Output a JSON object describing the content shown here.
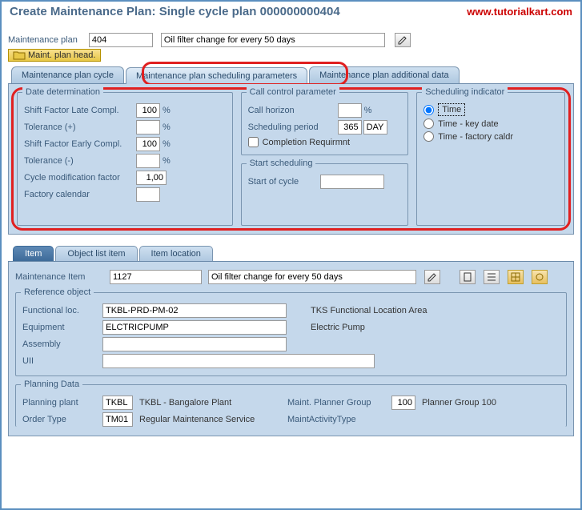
{
  "title": "Create Maintenance Plan: Single cycle plan 000000000404",
  "watermark": "www.tutorialkart.com",
  "header": {
    "plan_label": "Maintenance plan",
    "plan_value": "404",
    "plan_desc": "Oil filter change for every 50 days",
    "head_button": "Maint. plan head."
  },
  "tabs": {
    "t1": "Maintenance plan cycle",
    "t2": "Maintenance plan scheduling parameters",
    "t3": "Maintenance plan additional data"
  },
  "date_det": {
    "legend": "Date determination",
    "shift_late_label": "Shift Factor Late Compl.",
    "shift_late_val": "100",
    "tol_plus_label": "Tolerance (+)",
    "tol_plus_val": "",
    "shift_early_label": "Shift Factor Early Compl.",
    "shift_early_val": "100",
    "tol_minus_label": "Tolerance (-)",
    "tol_minus_val": "",
    "cycle_mod_label": "Cycle modification factor",
    "cycle_mod_val": "1,00",
    "factory_cal_label": "Factory calendar",
    "factory_cal_val": ""
  },
  "call_ctrl": {
    "legend": "Call control parameter",
    "horizon_label": "Call horizon",
    "horizon_val": "",
    "sched_period_label": "Scheduling period",
    "sched_period_val": "365",
    "sched_period_unit": "DAY",
    "completion_label": "Completion Requirmnt"
  },
  "sched_ind": {
    "legend": "Scheduling indicator",
    "opt1": "Time",
    "opt2": "Time - key date",
    "opt3": "Time - factory caldr"
  },
  "start_sched": {
    "legend": "Start scheduling",
    "start_label": "Start of cycle",
    "start_val": ""
  },
  "item_tabs": {
    "t1": "Item",
    "t2": "Object list item",
    "t3": "Item location"
  },
  "maint_item": {
    "label": "Maintenance Item",
    "value": "1127",
    "desc": "Oil filter change for every 50 days"
  },
  "ref_obj": {
    "legend": "Reference object",
    "func_loc_label": "Functional loc.",
    "func_loc_val": "TKBL-PRD-PM-02",
    "func_loc_desc": "TKS Functional Location Area",
    "equip_label": "Equipment",
    "equip_val": "ELCTRICPUMP",
    "equip_desc": "Electric Pump",
    "assy_label": "Assembly",
    "assy_val": "",
    "uii_label": "UII",
    "uii_val": ""
  },
  "plan_data": {
    "legend": "Planning Data",
    "plant_label": "Planning plant",
    "plant_val": "TKBL",
    "plant_desc": "TKBL - Bangalore Plant",
    "planner_grp_label": "Maint. Planner Group",
    "planner_grp_val": "100",
    "planner_grp_desc": "Planner Group 100",
    "order_type_label": "Order Type",
    "order_type_val": "TM01",
    "order_type_desc": "Regular Maintenance Service",
    "activity_label": "MaintActivityType"
  }
}
